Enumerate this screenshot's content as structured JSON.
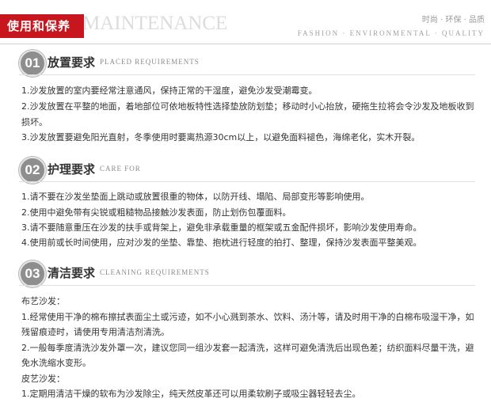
{
  "header": {
    "title_cn": "使用和保养",
    "title_en": "MAINTENANCE",
    "tags_cn": "时尚 · 环保 · 品质",
    "tags_en": "FASHION · ENVIRONMENTAL · QUALITY",
    "accent_color": "#c8161e"
  },
  "sections": [
    {
      "number": "01",
      "title_cn": "放置要求",
      "title_en": "PLACED REQUIREMENTS",
      "items": [
        "1.沙发放置的室内要经常注意通风，保持正常的干湿度，避免沙发受潮霉变。",
        "2.沙发放置在平整的地面，着地部位可依地板特性选择垫放防划垫；移动时小心抬放，硬拖生拉将会令沙发及地板收到",
        "损坏。",
        "3.沙发放置要避免阳光直射，冬季使用时要离热源30cm以上，以避免面料褪色，海绵老化，实木开裂。"
      ]
    },
    {
      "number": "02",
      "title_cn": "护理要求",
      "title_en": "CARE FOR",
      "items": [
        "1.请不要在沙发坐垫面上跳动或放置很重的物体，以防开线、塌陷、局部变形等影响使用。",
        "2.使用中避免带有尖锐或粗糙物品接触沙发表面，防止划伤包覆面料。",
        "3.请不要随意重压在沙发的扶手或背架上，避免非承载重量的框架或五金配件损坏，影响沙发使用寿命。",
        "4.使用前或长时间使用，应对沙发的坐垫、靠垫、抱枕进行轻度的拍打、整理，保持沙发表面平整美观。"
      ]
    },
    {
      "number": "03",
      "title_cn": "清洁要求",
      "title_en": "CLEANING REQUIREMENTS",
      "items": [
        "布艺沙发：",
        "1.经常使用干净的棉布擦拭表面尘土或污迹，如不小心溅到茶水、饮料、汤汁等，请及时用干净的白棉布吸湿干净，如",
        "残留痕迹时，请使用专用清洁剂清洗。",
        "2.一般每季度清洗沙发外罩一次，建议您同一组沙发套一起清洗，这样可避免清洗后出现色差；纺织面料尽量干洗，避",
        "免水洗缩水变形。",
        "皮艺沙发：",
        "1.定期用清洁干燥的软布为沙发除尘，纯天然皮革还可以用柔软刷子或吸尘器轻轻去尘。"
      ]
    }
  ]
}
